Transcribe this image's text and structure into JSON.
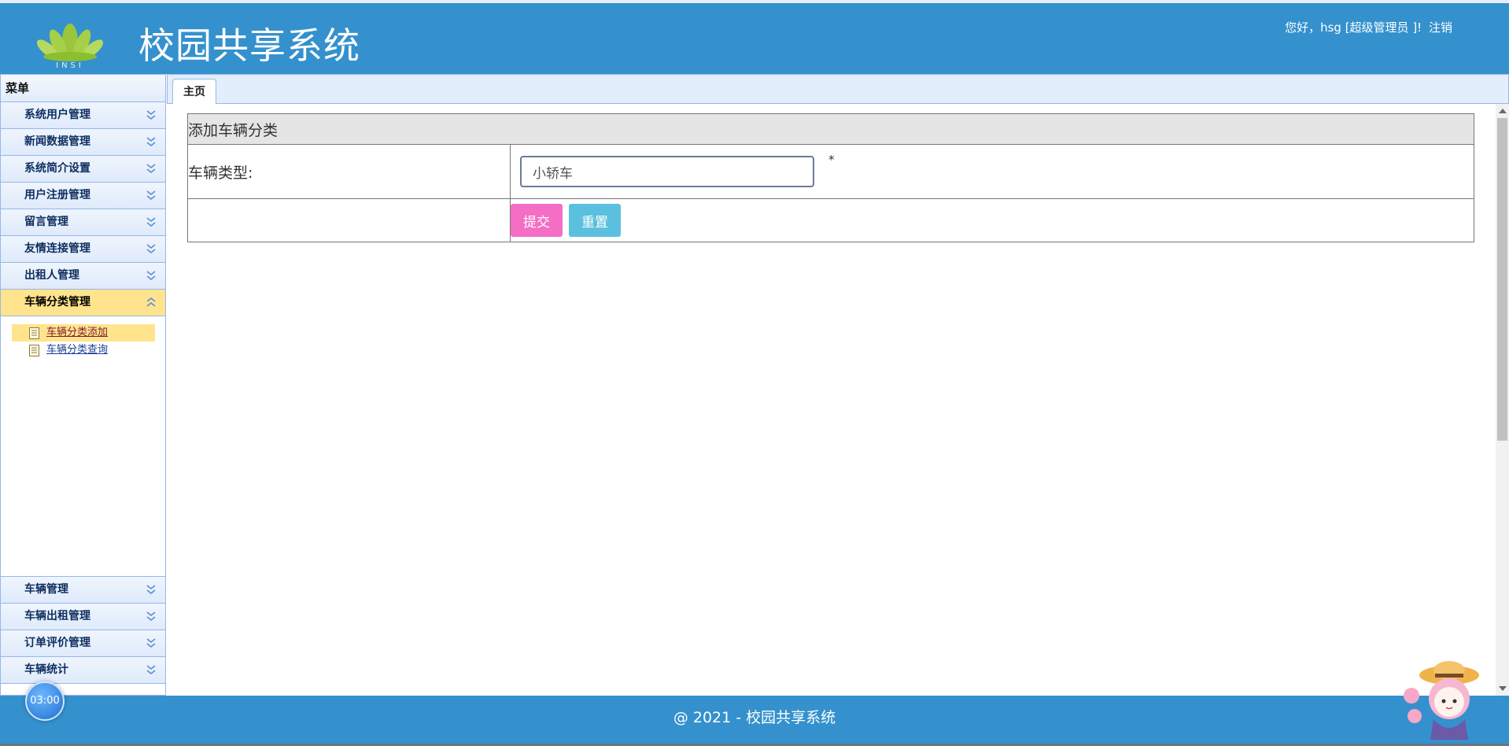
{
  "header": {
    "app_title": "校园共享系统",
    "greeting": "您好，hsg [超级管理员 ]!",
    "logout": "注销",
    "logo_text": "INSI"
  },
  "sidebar": {
    "title": "菜单",
    "items_top": [
      {
        "label": "系统用户管理"
      },
      {
        "label": "新闻数据管理"
      },
      {
        "label": "系统简介设置"
      },
      {
        "label": "用户注册管理"
      },
      {
        "label": "留言管理"
      },
      {
        "label": "友情连接管理"
      },
      {
        "label": "出租人管理"
      },
      {
        "label": "车辆分类管理"
      }
    ],
    "subitems": [
      {
        "label": "车辆分类添加"
      },
      {
        "label": "车辆分类查询"
      }
    ],
    "items_bottom": [
      {
        "label": "车辆管理"
      },
      {
        "label": "车辆出租管理"
      },
      {
        "label": "订单评价管理"
      },
      {
        "label": "车辆统计"
      }
    ]
  },
  "tabs": [
    {
      "label": "主页"
    }
  ],
  "form": {
    "heading": "添加车辆分类",
    "field_label": "车辆类型:",
    "field_value": "小轿车",
    "required_mark": "*",
    "submit_label": "提交",
    "reset_label": "重置"
  },
  "footer": {
    "text": "@ 2021 - 校园共享系统"
  },
  "widget": {
    "timer": "03:00"
  },
  "colors": {
    "header_bg": "#3491cd",
    "active_menu": "#ffe48d",
    "submit": "#f46ec6",
    "reset": "#5bc0de"
  }
}
